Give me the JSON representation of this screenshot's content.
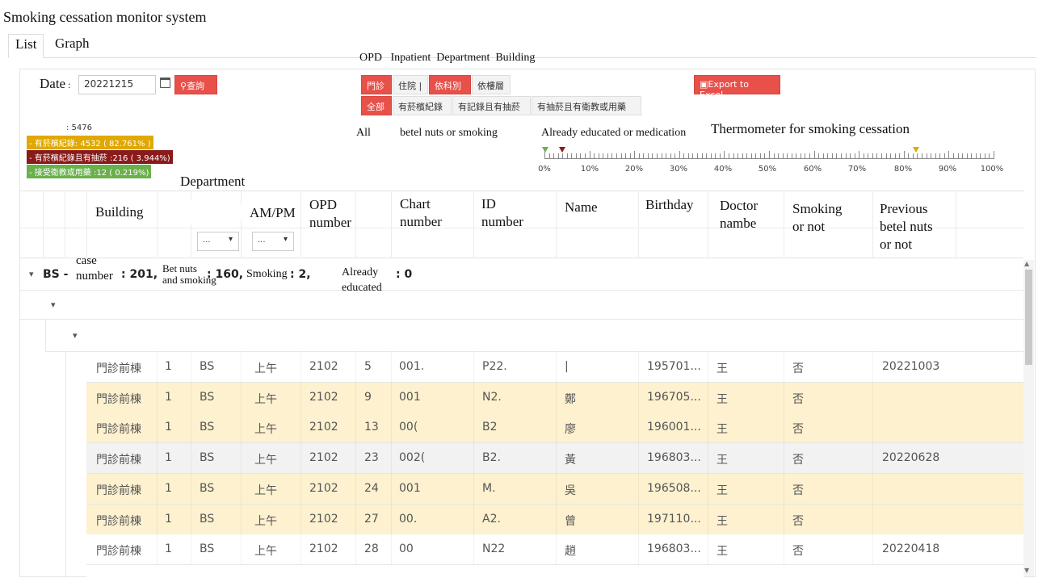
{
  "app_title": "Smoking cessation monitor system",
  "tabs": [
    {
      "label": "List"
    },
    {
      "label": "Graph"
    }
  ],
  "filters": {
    "section_caption": "OPD   Inpatient  Department  Building",
    "date_label": "Date",
    "date_value": "20221215",
    "query_label": "查詢",
    "export_label": "Export to Excel",
    "visit_type": {
      "opd": "門診",
      "inpatient": "住院"
    },
    "group_by": {
      "department": "依科別",
      "building": "依樓層"
    },
    "record_filter": {
      "all": "全部",
      "betel_records": "有菸檳紀錄",
      "records_smoking": "有記錄且有抽菸",
      "smoking_educated": "有抽菸且有衛教或用藥"
    },
    "captions": {
      "all": "All",
      "betel_or_smoking": "betel nuts or smoking",
      "educated": "Already educated or medication",
      "thermometer": "Thermometer for smoking cessation"
    }
  },
  "summary": {
    "total": ": 5476",
    "betel_records": "- 有菸檳紀錄: 4532 ( 82.761% )",
    "records_smoking": "- 有菸檳紀錄且有抽菸 :216 ( 3.944%)",
    "educated": "- 接受衛教或用藥 :12 ( 0.219%)",
    "department_caption": "Department"
  },
  "thermometer": {
    "ticks": [
      "0%",
      "10%",
      "20%",
      "30%",
      "40%",
      "50%",
      "60%",
      "70%",
      "80%",
      "90%",
      "100%"
    ],
    "markers": [
      {
        "name": "educated",
        "percent": 0.219,
        "color": "#6ab04c"
      },
      {
        "name": "smoking",
        "percent": 3.944,
        "color": "#8b1a1a"
      },
      {
        "name": "betel_records",
        "percent": 82.761,
        "color": "#e0a800"
      }
    ]
  },
  "table": {
    "headers": {
      "building": "Building",
      "ampm": "AM/PM",
      "opd_number": "OPD\nnumber",
      "chart_number": "Chart\nnumber",
      "id_number": "ID\nnumber",
      "name": "Name",
      "birthday": "Birthday",
      "doctor_name": "Doctor\nnambe",
      "smoking": "Smoking\nor not",
      "prev_betel": "Previous\nbetel nuts\nor not"
    },
    "filter_placeholder": "...",
    "group_summary": {
      "prefix": "BS -",
      "case_label": "case\nnumber",
      "case_value": ": 201,",
      "betel_label": "Bet nuts\nand smoking",
      "betel_value": ": 160,",
      "smoking_label": "Smoking",
      "smoking_value": ": 2,",
      "educated_label": "Already\neducated",
      "educated_value": ": 0"
    },
    "rows": [
      {
        "bld": "門診前棟",
        "floor": "1",
        "dept": "BS",
        "ampm": "上午",
        "opd": "2102",
        "seq": "5",
        "chart": "001.",
        "id": "P22.",
        "name": "|",
        "birthday": "195701...",
        "doctor": "王",
        "smoking": "否",
        "prev": "20221003",
        "style": "white"
      },
      {
        "bld": "門診前棟",
        "floor": "1",
        "dept": "BS",
        "ampm": "上午",
        "opd": "2102",
        "seq": "9",
        "chart": "001",
        "id": "N2.",
        "name": "鄭",
        "birthday": "196705...",
        "doctor": "王",
        "smoking": "否",
        "prev": "",
        "style": "yellow"
      },
      {
        "bld": "門診前棟",
        "floor": "1",
        "dept": "BS",
        "ampm": "上午",
        "opd": "2102",
        "seq": "13",
        "chart": "00(",
        "id": "B2",
        "name": "廖",
        "birthday": "196001...",
        "doctor": "王",
        "smoking": "否",
        "prev": "",
        "style": "yellow"
      },
      {
        "bld": "門診前棟",
        "floor": "1",
        "dept": "BS",
        "ampm": "上午",
        "opd": "2102",
        "seq": "23",
        "chart": "002(",
        "id": "B2.",
        "name": "黃",
        "birthday": "196803...",
        "doctor": "王",
        "smoking": "否",
        "prev": "20220628",
        "style": "grey"
      },
      {
        "bld": "門診前棟",
        "floor": "1",
        "dept": "BS",
        "ampm": "上午",
        "opd": "2102",
        "seq": "24",
        "chart": "001",
        "id": "M.",
        "name": "吳",
        "birthday": "196508...",
        "doctor": "王",
        "smoking": "否",
        "prev": "",
        "style": "yellow"
      },
      {
        "bld": "門診前棟",
        "floor": "1",
        "dept": "BS",
        "ampm": "上午",
        "opd": "2102",
        "seq": "27",
        "chart": "00.",
        "id": "A2.",
        "name": "曾",
        "birthday": "197110...",
        "doctor": "王",
        "smoking": "否",
        "prev": "",
        "style": "yellow"
      },
      {
        "bld": "門診前棟",
        "floor": "1",
        "dept": "BS",
        "ampm": "上午",
        "opd": "2102",
        "seq": "28",
        "chart": "00",
        "id": "N22",
        "name": "趙",
        "birthday": "196803...",
        "doctor": "王",
        "smoking": "否",
        "prev": "20220418",
        "style": "white"
      }
    ]
  },
  "colors": {
    "accent_red": "#e8504a",
    "highlight_yellow": "#fdf1cf",
    "betel_bar": "#e0a800",
    "smoking_bar": "#8b1a1a",
    "educated_bar": "#6ab04c"
  }
}
